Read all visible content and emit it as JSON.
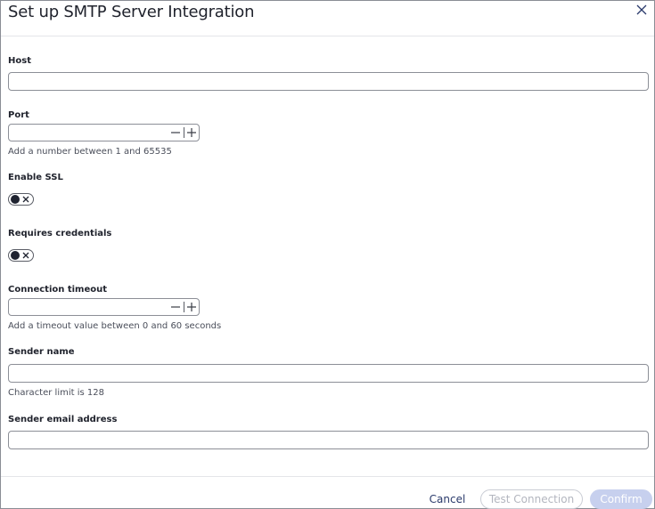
{
  "dialog": {
    "title": "Set up SMTP Server Integration",
    "close_icon": "close-icon"
  },
  "fields": {
    "host": {
      "label": "Host",
      "value": "",
      "placeholder": ""
    },
    "port": {
      "label": "Port",
      "value": "",
      "help": "Add a number between 1 and 65535"
    },
    "enable_ssl": {
      "label": "Enable SSL",
      "checked": false
    },
    "requires_credentials": {
      "label": "Requires credentials",
      "checked": false
    },
    "connection_timeout": {
      "label": "Connection timeout",
      "value": "",
      "help": "Add a timeout value between 0 and 60 seconds"
    },
    "sender_name": {
      "label": "Sender name",
      "value": "",
      "help": "Character limit is 128"
    },
    "sender_email": {
      "label": "Sender email address",
      "value": ""
    }
  },
  "footer": {
    "cancel_label": "Cancel",
    "test_label": "Test Connection",
    "confirm_label": "Confirm"
  },
  "colors": {
    "primary_disabled": "#c7d0ee",
    "cancel_text": "#2a3a6b",
    "border": "#8c8f97"
  }
}
